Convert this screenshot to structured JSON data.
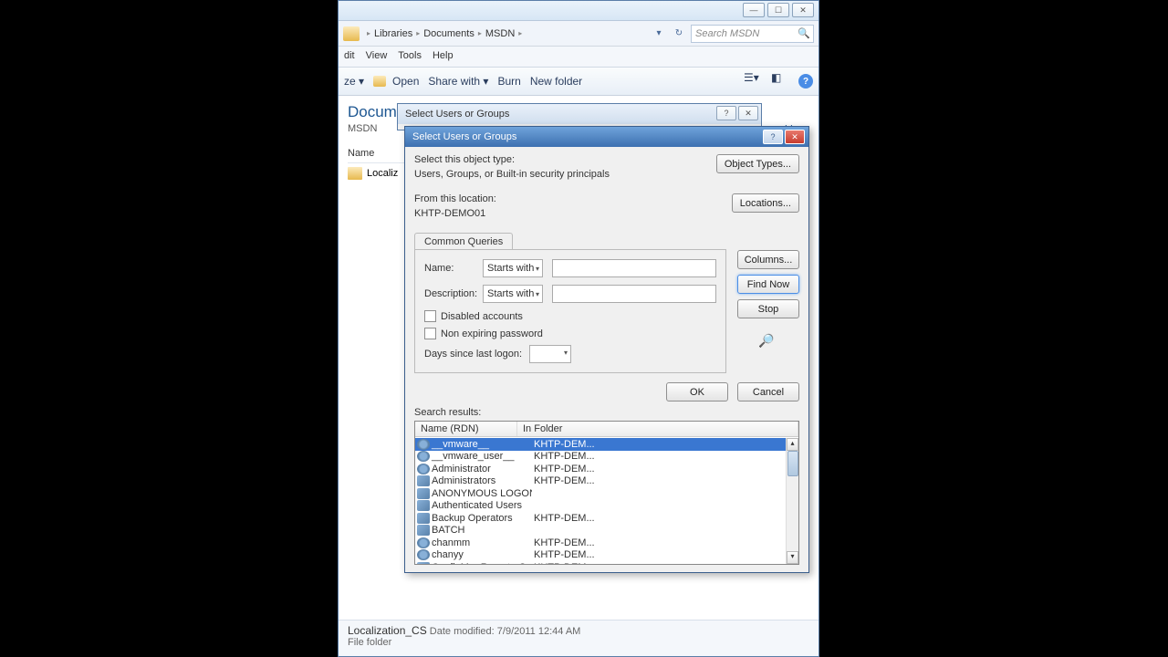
{
  "window": {
    "breadcrumb": [
      "Libraries",
      "Documents",
      "MSDN"
    ],
    "search_placeholder": "Search MSDN",
    "menu": {
      "edit": "dit",
      "view": "View",
      "tools": "Tools",
      "help": "Help"
    },
    "toolbar": {
      "organize_suffix": "ze ▾",
      "open": "Open",
      "share": "Share with ▾",
      "burn": "Burn",
      "newfolder": "New folder"
    },
    "library_title": "Documents library",
    "library_sub": "MSDN",
    "arrange": "older ▾",
    "col_name": "Name",
    "file1": "Localiz",
    "status_name": "Localization_CS",
    "status_meta_label": "Date modified:",
    "status_meta_value": "7/9/2011 12:44 AM",
    "status_type": "File folder"
  },
  "outer_dialog": {
    "title": "Select Users or Groups"
  },
  "dialog": {
    "title": "Select Users or Groups",
    "object_type_label": "Select this object type:",
    "object_type_value": "Users, Groups, or Built-in security principals",
    "object_types_btn": "Object Types...",
    "location_label": "From this location:",
    "location_value": "KHTP-DEMO01",
    "locations_btn": "Locations...",
    "tab": "Common Queries",
    "name_label": "Name:",
    "desc_label": "Description:",
    "starts_with": "Starts with",
    "disabled_accounts": "Disabled accounts",
    "non_expiring": "Non expiring password",
    "days_since": "Days since last logon:",
    "columns_btn": "Columns...",
    "findnow_btn": "Find Now",
    "stop_btn": "Stop",
    "ok": "OK",
    "cancel": "Cancel",
    "search_results": "Search results:",
    "res_col1": "Name (RDN)",
    "res_col2": "In Folder",
    "results": [
      {
        "name": "__vmware__",
        "folder": "KHTP-DEM...",
        "sel": true,
        "t": "u"
      },
      {
        "name": "__vmware_user__",
        "folder": "KHTP-DEM...",
        "t": "u"
      },
      {
        "name": "Administrator",
        "folder": "KHTP-DEM...",
        "t": "u"
      },
      {
        "name": "Administrators",
        "folder": "KHTP-DEM...",
        "t": "g"
      },
      {
        "name": "ANONYMOUS LOGON",
        "folder": "",
        "t": "g"
      },
      {
        "name": "Authenticated Users",
        "folder": "",
        "t": "g"
      },
      {
        "name": "Backup Operators",
        "folder": "KHTP-DEM...",
        "t": "g"
      },
      {
        "name": "BATCH",
        "folder": "",
        "t": "g"
      },
      {
        "name": "chanmm",
        "folder": "KHTP-DEM...",
        "t": "u"
      },
      {
        "name": "chanyy",
        "folder": "KHTP-DEM...",
        "t": "u"
      },
      {
        "name": "ConfigMgr Remote Co...",
        "folder": "KHTP-DEM...",
        "t": "g"
      }
    ]
  }
}
